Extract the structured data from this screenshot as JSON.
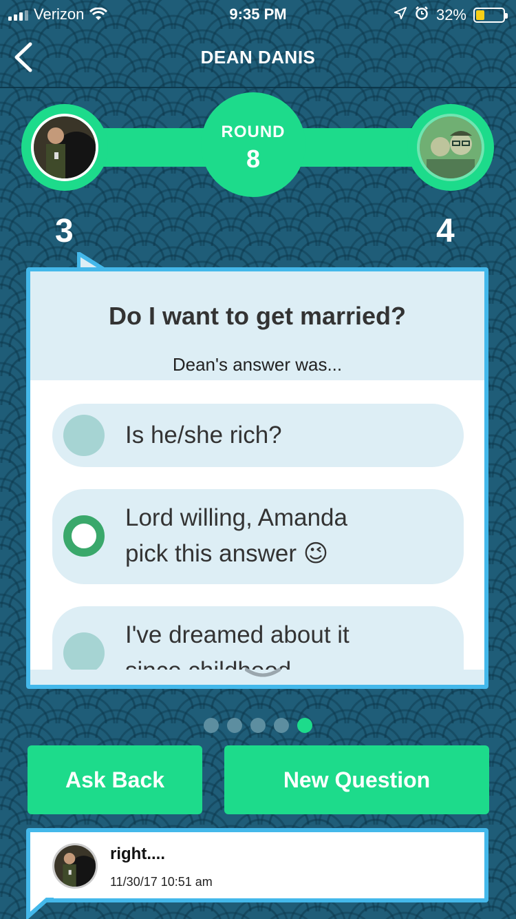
{
  "status_bar": {
    "carrier": "Verizon",
    "time": "9:35 PM",
    "battery_percent": "32%",
    "battery_level": 0.32,
    "icons": [
      "signal-icon",
      "wifi-icon",
      "location-arrow-icon",
      "alarm-clock-icon",
      "battery-icon"
    ]
  },
  "nav": {
    "title": "DEAN DANIS",
    "back_icon": "chevron-left-icon"
  },
  "round": {
    "label": "ROUND",
    "number": "8"
  },
  "scores": {
    "left": "3",
    "right": "4"
  },
  "question": {
    "text": "Do I want to get married?",
    "answer_intro": "Dean's answer was...",
    "options": [
      {
        "line1": "Is he/she rich?",
        "line2": "",
        "selected": false
      },
      {
        "line1": "Lord willing, Amanda",
        "line2": "pick this answer 😉",
        "selected": true
      },
      {
        "line1": "I've dreamed about it",
        "line2": "since childhood",
        "selected": false
      }
    ]
  },
  "pager": {
    "count": 5,
    "active_index": 4
  },
  "buttons": {
    "ask_back": "Ask Back",
    "new_question": "New Question"
  },
  "message": {
    "text": "right....",
    "timestamp": "11/30/17 10:51 am"
  },
  "colors": {
    "accent_green": "#1ddb8b",
    "card_border_blue": "#44b8ea",
    "background_teal": "#1f5d78",
    "selected_radio_green": "#3aa86b",
    "battery_yellow": "#f7cf17"
  }
}
